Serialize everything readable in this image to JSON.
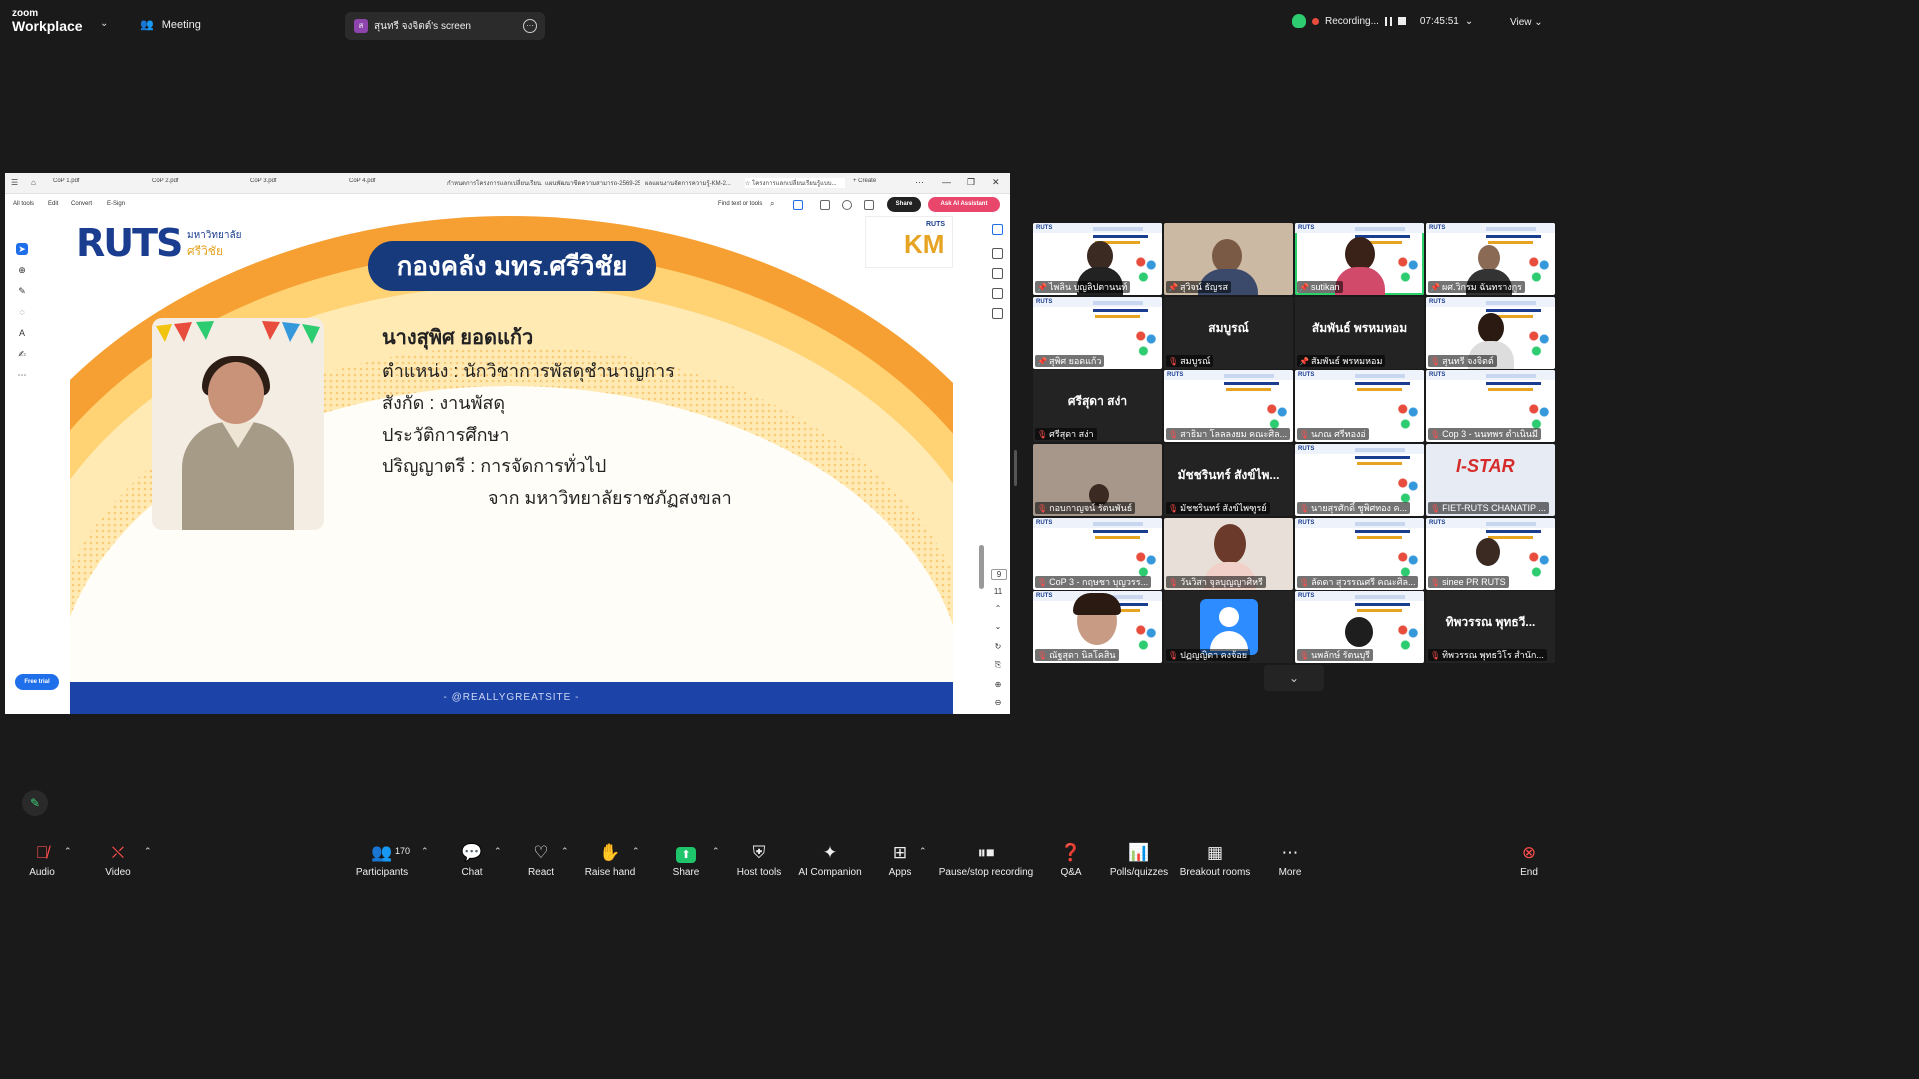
{
  "app": {
    "logo_top": "zoom",
    "logo_bottom": "Workplace"
  },
  "topbar": {
    "meeting_label": "Meeting",
    "share_tab_label": "สุนทรี จงจิตต์'s screen",
    "share_badge": "ส",
    "recording_label": "Recording...",
    "timer": "07:45:51",
    "view_label": "View"
  },
  "pdf": {
    "tabs": [
      "CoP 1.pdf",
      "CoP 2.pdf",
      "CoP 3.pdf",
      "CoP 4.pdf",
      "กำหนดการโครงการแลกเปลี่ยนเรียน...",
      "แผนพัฒนาขีดความสามารถ-2569-257...",
      "ผลแผนงานจัดการความรู้-KM-2...",
      "โครงการแลกเปลี่ยนเรียนรู้แบบ..."
    ],
    "create_label": "+ Create",
    "menu": [
      "All tools",
      "Edit",
      "Convert",
      "E-Sign"
    ],
    "find_label": "Find text or tools",
    "share_label": "Share",
    "ai_label": "Ask AI Assistant",
    "free_trial": "Free trial",
    "page_num": "9",
    "page_total": "11"
  },
  "slide": {
    "logo": "RUTS",
    "logo_sub1": "มหาวิทยาลัย",
    "logo_sub2": "ศรีวิชัย",
    "km_logo": "KM",
    "km_logo_small": "RUTS",
    "title": "กองคลัง มทร.ศรีวิชัย",
    "name": "นางสุพิศ  ยอดแก้ว",
    "line1": "ตำแหน่ง     : นักวิชาการพัสดุชำนาญการ",
    "line2": "สังกัด        :  งานพัสดุ",
    "line3": "ประวัติการศึกษา",
    "line4": "ปริญญาตรี : การจัดการทั่วไป",
    "line5": "จาก มหาวิทยาลัยราชภัฏสงขลา",
    "footer": "- @REALLYGREATSITE -"
  },
  "participants_tiles": [
    {
      "name": "ไพลิน บุญลิปตานนท์",
      "type": "video"
    },
    {
      "name": "สุวิจน์ ธัญรส",
      "type": "video"
    },
    {
      "name": "sutikan",
      "type": "video"
    },
    {
      "name": "ผศ.วิกรม ฉันทรางกูร",
      "type": "video"
    },
    {
      "name": "สุพิศ ยอดแก้ว",
      "type": "video"
    },
    {
      "name": "สมบูรณ์",
      "big": "สมบูรณ์",
      "type": "name"
    },
    {
      "name": "สัมพันธ์ พรหมหอม",
      "big": "สัมพันธ์ พรหมหอม",
      "type": "name"
    },
    {
      "name": "สุนทรี จงจิตต์",
      "type": "video"
    },
    {
      "name": "ศรีสุดา สง่า",
      "big": "ศรีสุดา สง่า",
      "type": "name"
    },
    {
      "name": "สาธิมา โลลลงยม คณะศิล...",
      "type": "video"
    },
    {
      "name": "นภณ ศรีทองอ่",
      "type": "video"
    },
    {
      "name": "Cop 3 - นนทพร ตำเนินมี",
      "type": "video"
    },
    {
      "name": "กอบกาญจน์ รัตนพันธ์",
      "type": "video"
    },
    {
      "name": "มัชชรินทร์ สังข์ไพ...",
      "big": "มัชชรินทร์ สังข์ไพ...",
      "label": "มัชชรินทร์ สังข์ไพฑูรย์",
      "type": "name"
    },
    {
      "name": "นายสุรศักดิ์ ชูพิศทอง ค...",
      "type": "video"
    },
    {
      "name": "FIET-RUTS CHANATIP ...",
      "type": "video"
    },
    {
      "name": "CoP 3 - กฤษชา บุญวรร...",
      "type": "video"
    },
    {
      "name": "วันวิสา จุลบุญญาศิหรี",
      "type": "video"
    },
    {
      "name": "ลัดดา สุวรรณศรี คณะศิล...",
      "type": "video"
    },
    {
      "name": "sinee PR RUTS",
      "type": "video"
    },
    {
      "name": "ณัฐสุดา นิลโคสิน",
      "type": "video"
    },
    {
      "name": "ปฏญญิตา คงจ้อย",
      "type": "avatar"
    },
    {
      "name": "นพลักษ์ รัตนบุรี",
      "type": "video"
    },
    {
      "name": "ทิพวรรณ พุทธวิโร สำนัก...",
      "big": "ทิพวรรณ พุทธวี...",
      "type": "name"
    }
  ],
  "istar_text": "I-STAR",
  "bottombar": {
    "audio": "Audio",
    "video": "Video",
    "participants": "Participants",
    "participants_count": "170",
    "chat": "Chat",
    "react": "React",
    "raise_hand": "Raise hand",
    "share": "Share",
    "host_tools": "Host tools",
    "ai_companion": "AI Companion",
    "apps": "Apps",
    "pause_recording": "Pause/stop recording",
    "qa": "Q&A",
    "polls": "Polls/quizzes",
    "breakout": "Breakout rooms",
    "more": "More",
    "end": "End"
  }
}
